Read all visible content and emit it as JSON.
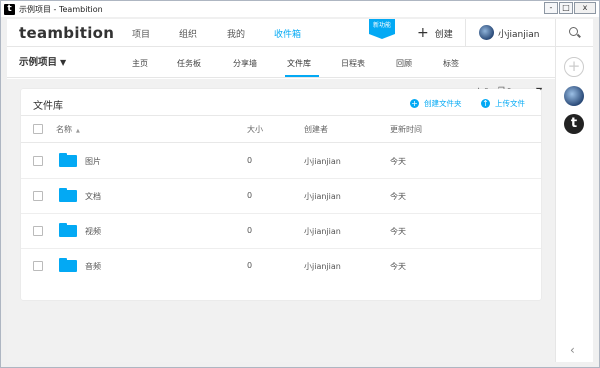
{
  "window": {
    "title": "示例项目 - Teambition",
    "app_icon": "t",
    "buttons": [
      "-",
      "□",
      "x"
    ]
  },
  "topnav": {
    "logo": "teambition",
    "items": [
      {
        "label": "项目",
        "active": false
      },
      {
        "label": "组织",
        "active": false
      },
      {
        "label": "我的",
        "active": false
      },
      {
        "label": "收件箱",
        "active": true
      }
    ],
    "new_badge": "新功能",
    "create_label": "创建",
    "user_name": "小jianjian"
  },
  "subnav": {
    "project_name": "示例项目",
    "items": [
      {
        "label": "主页",
        "active": false
      },
      {
        "label": "任务板",
        "active": false
      },
      {
        "label": "分享墙",
        "active": false
      },
      {
        "label": "文件库",
        "active": true
      },
      {
        "label": "日程表",
        "active": false
      },
      {
        "label": "回顾",
        "active": false
      },
      {
        "label": "标签",
        "active": false
      }
    ]
  },
  "counts": {
    "stars": "0",
    "files": "0"
  },
  "library": {
    "title": "文件库",
    "create_folder": "创建文件夹",
    "upload_file": "上传文件",
    "columns": {
      "name": "名称",
      "size": "大小",
      "creator": "创建者",
      "updated": "更新时间"
    },
    "rows": [
      {
        "name": "图片",
        "size": "0",
        "creator": "小jianjian",
        "updated": "今天"
      },
      {
        "name": "文档",
        "size": "0",
        "creator": "小jianjian",
        "updated": "今天"
      },
      {
        "name": "视频",
        "size": "0",
        "creator": "小jianjian",
        "updated": "今天"
      },
      {
        "name": "音频",
        "size": "0",
        "creator": "小jianjian",
        "updated": "今天"
      }
    ]
  },
  "colors": {
    "accent": "#03a9f4",
    "background": "#f1f1f1",
    "text": "#333333"
  },
  "icons": [
    "search-icon",
    "plus-icon",
    "star-icon",
    "copy-icon",
    "folder-icon",
    "collapse-icon",
    "create-folder-icon",
    "upload-icon"
  ]
}
